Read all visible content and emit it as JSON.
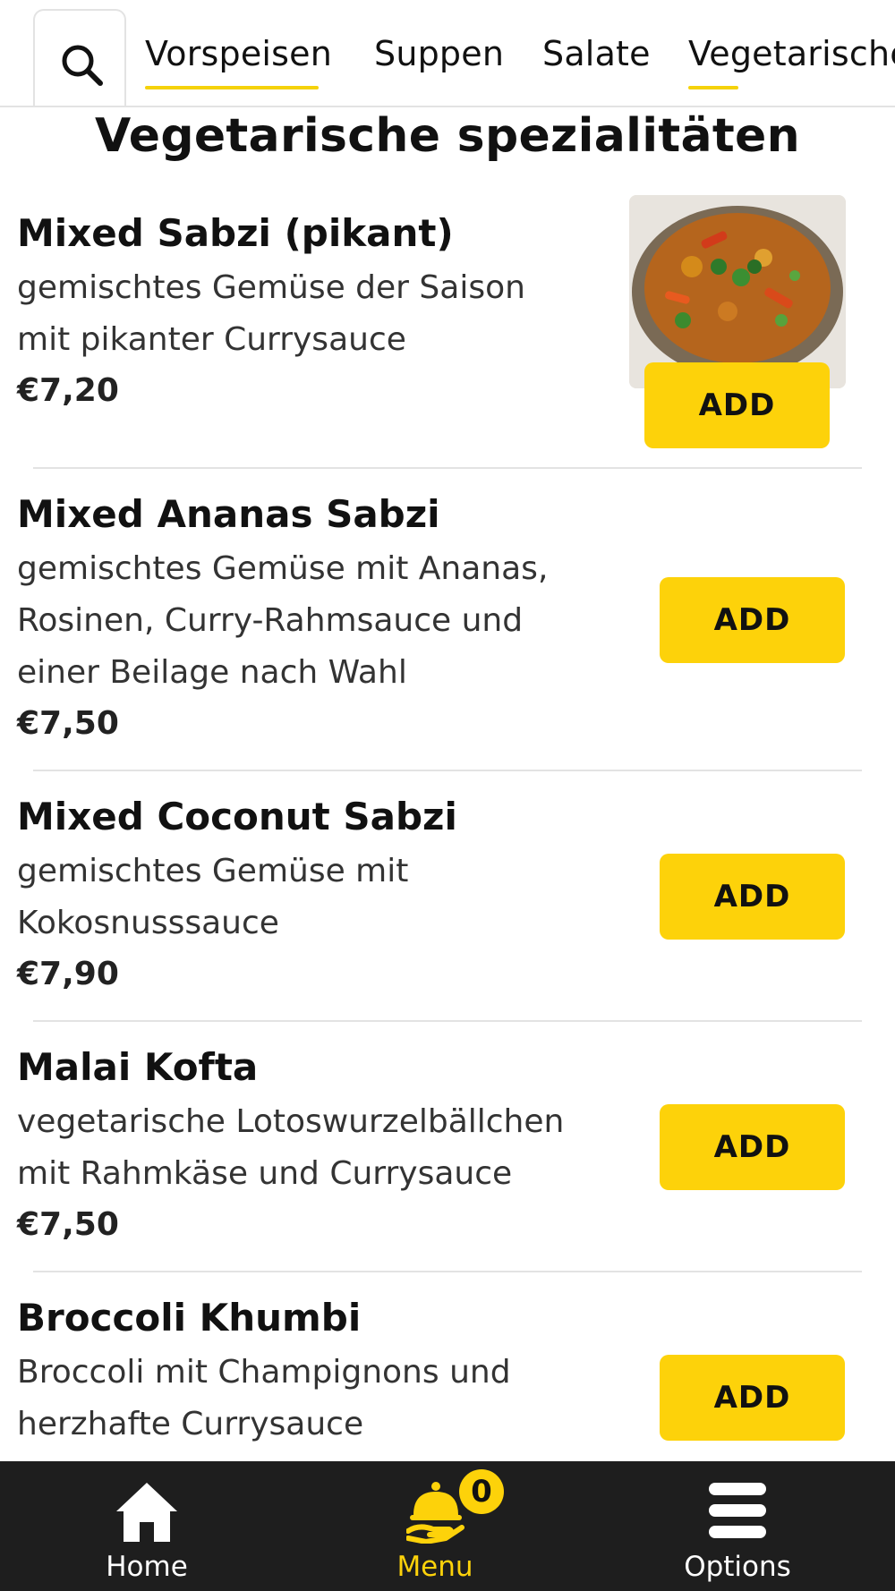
{
  "tabs": [
    {
      "label": "Vorspeisen",
      "active": false
    },
    {
      "label": "Suppen",
      "active": false
    },
    {
      "label": "Salate",
      "active": false
    },
    {
      "label": "Vegetarische spezialitäten",
      "active": true
    }
  ],
  "section": {
    "title": "Vegetarische spezialitäten"
  },
  "items": [
    {
      "name": "Mixed Sabzi (pikant)",
      "desc": [
        "gemischtes Gemüse der Saison",
        "mit pikanter Currysauce"
      ],
      "price": "€7,20",
      "add": "ADD",
      "has_image": true
    },
    {
      "name": "Mixed Ananas Sabzi",
      "desc": [
        "gemischtes Gemüse mit Ananas,",
        "Rosinen, Curry-Rahmsauce und",
        "einer Beilage nach Wahl"
      ],
      "price": "€7,50",
      "add": "ADD"
    },
    {
      "name": "Mixed Coconut Sabzi",
      "desc": [
        "gemischtes Gemüse mit",
        "Kokosnusssauce"
      ],
      "price": "€7,90",
      "add": "ADD"
    },
    {
      "name": "Malai Kofta",
      "desc": [
        "vegetarische Lotoswurzelbällchen",
        "mit Rahmkäse und Currysauce"
      ],
      "price": "€7,50",
      "add": "ADD"
    },
    {
      "name": "Broccoli Khumbi",
      "desc": [
        "Broccoli mit Champignons und",
        "herzhafte Currysauce"
      ],
      "price": "",
      "add": "ADD"
    }
  ],
  "nav": {
    "home": "Home",
    "menu": "Menu",
    "options": "Options",
    "cart_count": "0"
  },
  "colors": {
    "accent": "#fdd20a",
    "nav_bg": "#1e1e1e",
    "active_nav": "#fdd20a"
  },
  "icons": [
    "search-icon",
    "home-icon",
    "menu-cloche-icon",
    "options-hamburger-icon"
  ]
}
